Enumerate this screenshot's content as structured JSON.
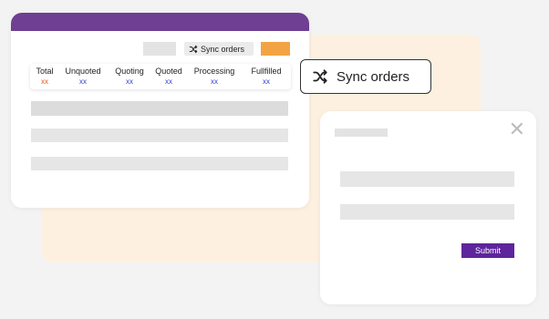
{
  "toolbar": {
    "sync_label": "Sync orders"
  },
  "stats": [
    {
      "label": "Total",
      "value": "xx",
      "value_color": "#e05a1c"
    },
    {
      "label": "Unquoted",
      "value": "xx",
      "value_color": "#3340c8"
    },
    {
      "label": "Quoting",
      "value": "xx",
      "value_color": "#3340c8"
    },
    {
      "label": "Quoted",
      "value": "xx",
      "value_color": "#3340c8"
    },
    {
      "label": "Processing",
      "value": "xx",
      "value_color": "#3340c8"
    },
    {
      "label": "Fullfilled",
      "value": "xx",
      "value_color": "#3340c8"
    }
  ],
  "sync_callout": {
    "label": "Sync orders",
    "icon": "shuffle-icon"
  },
  "dialog": {
    "submit_label": "Submit",
    "close_symbol": "✕"
  },
  "colors": {
    "header_purple": "#6e3f92",
    "accent_orange": "#f2a444",
    "submit_purple": "#5e259c",
    "peach_background": "#fdf0e0"
  }
}
